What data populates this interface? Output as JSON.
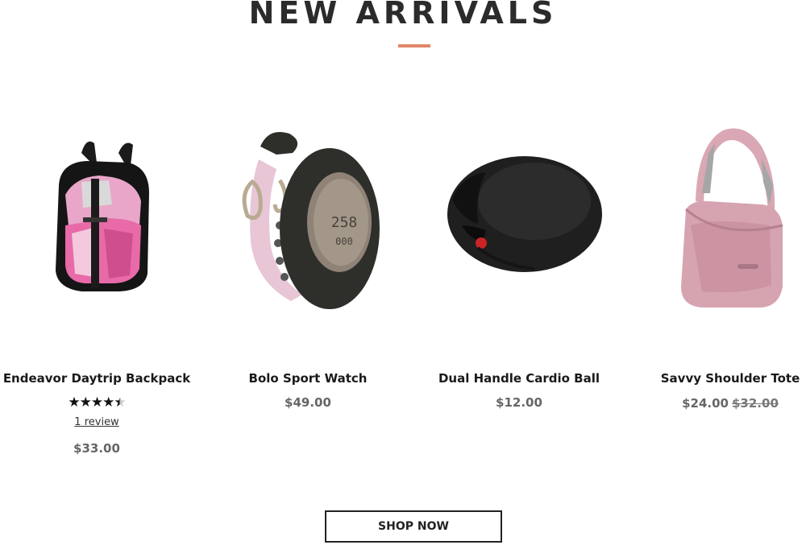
{
  "section": {
    "title": "NEW ARRIVALS",
    "accent_color": "#e0866a"
  },
  "products": [
    {
      "name": "Endeavor Daytrip Backpack",
      "image_icon": "backpack-image",
      "rating": 4.5,
      "rating_max": 5,
      "review_link": "1 review",
      "price": "$33.00"
    },
    {
      "name": "Bolo Sport Watch",
      "image_icon": "watch-image",
      "price": "$49.00"
    },
    {
      "name": "Dual Handle Cardio Ball",
      "image_icon": "cardio-ball-image",
      "price": "$12.00"
    },
    {
      "name": "Savvy Shoulder Tote",
      "image_icon": "tote-bag-image",
      "price": "$24.00",
      "old_price": "$32.00"
    }
  ],
  "cta": {
    "label": "SHOP NOW"
  }
}
